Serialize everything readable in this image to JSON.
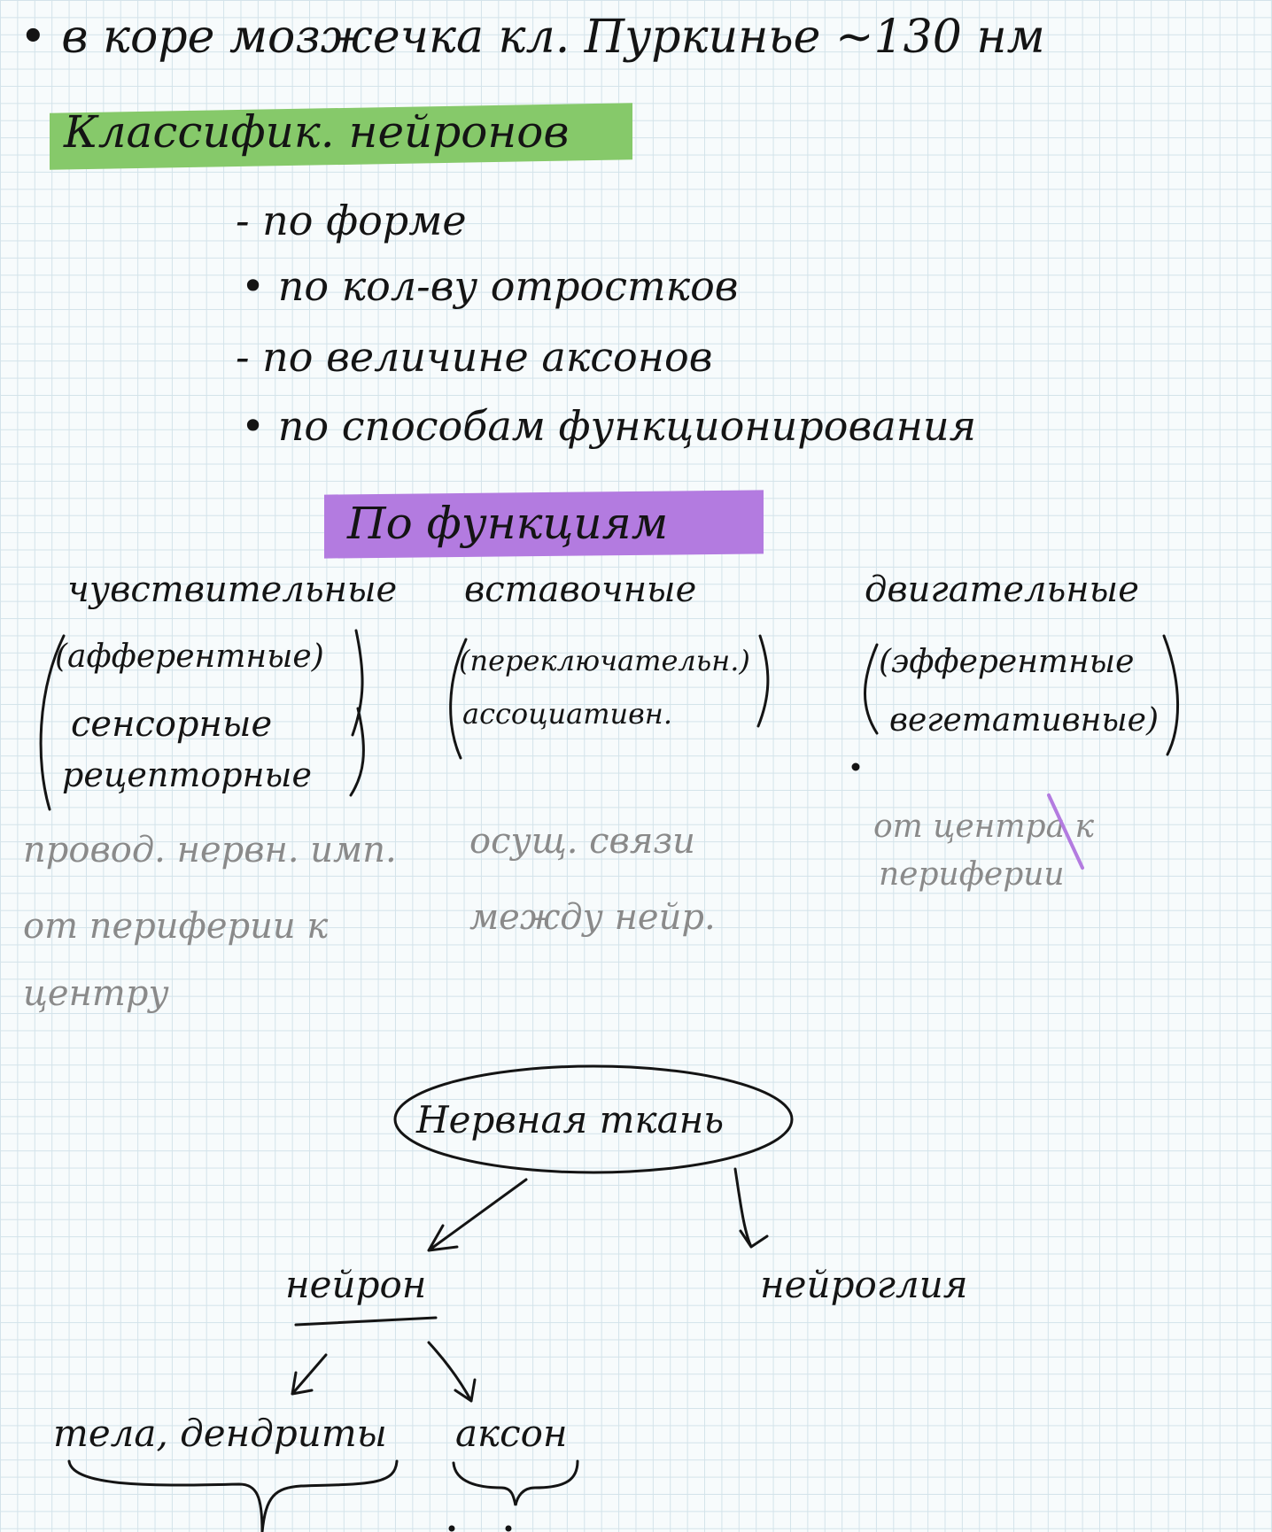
{
  "top_note": "• в коре мозжечка кл. Пуркинье ~130 нм",
  "classification": {
    "heading": "Классифик. нейронов",
    "highlight_color": "#86c96a",
    "items": [
      "- по форме",
      "• по кол-ву отростков",
      "- по величине аксонов",
      "• по способам функционирования"
    ]
  },
  "by_function": {
    "heading": "По функциям",
    "highlight_color": "#b37be0",
    "sensory": {
      "title": "чувствительные",
      "terms": [
        "(афферентные)",
        "сенсорные",
        "рецепторные"
      ],
      "note": [
        "провод. нервн. имп.",
        "от периферии к",
        "центру"
      ]
    },
    "intercalary": {
      "title": "вставочные",
      "terms": [
        "(переключательн.)",
        "ассоциативн."
      ],
      "note": [
        "осущ. связи",
        "между нейр."
      ]
    },
    "motor": {
      "title": "двигательные",
      "terms": [
        "(эфферентные",
        "вегетативные)"
      ],
      "note": [
        "от центра к",
        "периферии"
      ]
    }
  },
  "tree": {
    "root": "Нервная ткань",
    "neuron": "нейрон",
    "glia": "нейроглия",
    "body": "тела, дендриты",
    "axon": "аксон"
  }
}
